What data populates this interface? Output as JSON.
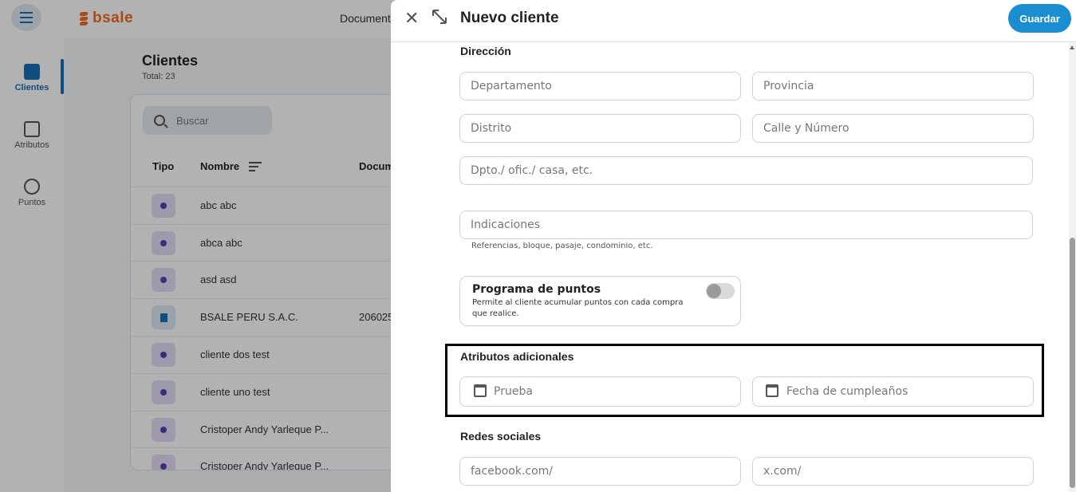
{
  "app": {
    "brand": "bsale",
    "top_link": "Documentos",
    "sidebar": [
      {
        "label": "Clientes",
        "active": true
      },
      {
        "label": "Atributos",
        "active": false
      },
      {
        "label": "Puntos",
        "active": false
      }
    ],
    "page_title": "Clientes",
    "page_subtitle": "Total: 23",
    "search_placeholder": "Buscar",
    "table": {
      "headers": [
        "Tipo",
        "Nombre",
        "Documento"
      ],
      "rows": [
        {
          "type": "person",
          "name": "abc abc",
          "doc": ""
        },
        {
          "type": "person",
          "name": "abca abc",
          "doc": ""
        },
        {
          "type": "person",
          "name": "asd asd",
          "doc": ""
        },
        {
          "type": "company",
          "name": "BSALE PERU S.A.C.",
          "doc": "206025"
        },
        {
          "type": "person",
          "name": "cliente dos test",
          "doc": ""
        },
        {
          "type": "person",
          "name": "cliente uno test",
          "doc": ""
        },
        {
          "type": "person",
          "name": "Cristoper Andy Yarleque P...",
          "doc": ""
        },
        {
          "type": "person",
          "name": "Cristoper Andy Yarleque P...",
          "doc": ""
        }
      ]
    }
  },
  "drawer": {
    "title": "Nuevo cliente",
    "save_label": "Guardar",
    "address": {
      "section_label": "Dirección",
      "departamento_placeholder": "Departamento",
      "provincia_placeholder": "Provincia",
      "distrito_placeholder": "Distrito",
      "calle_placeholder": "Calle y Número",
      "dpto_placeholder": "Dpto./ ofic./ casa, etc.",
      "indicaciones_placeholder": "Indicaciones",
      "indicaciones_helper": "Referencias, bloque, pasaje, condominio, etc."
    },
    "points": {
      "title": "Programa de puntos",
      "description": "Permite al cliente acumular puntos con cada compra que realice.",
      "enabled": false
    },
    "attributes": {
      "section_label": "Atributos adicionales",
      "prueba_placeholder": "Prueba",
      "birthday_placeholder": "Fecha de cumpleaños"
    },
    "social": {
      "section_label": "Redes sociales",
      "facebook_placeholder": "facebook.com/",
      "x_placeholder": "x.com/"
    }
  },
  "colors": {
    "primary": "#1a8ed1",
    "brand": "#f26b21",
    "highlight_border": "#000000"
  }
}
